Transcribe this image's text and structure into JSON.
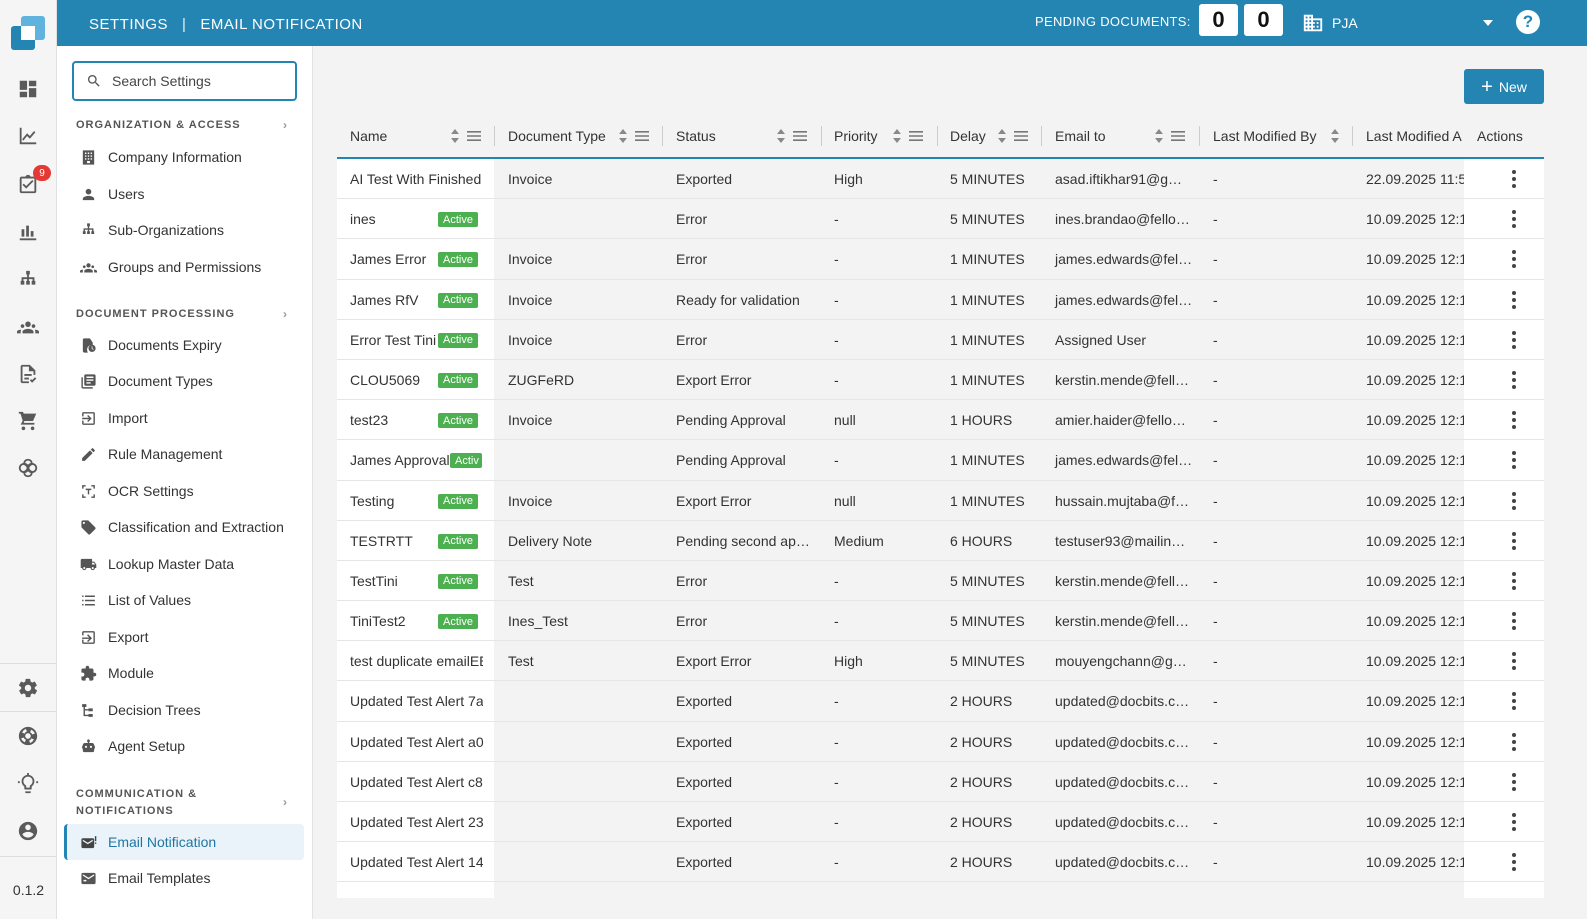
{
  "topbar": {
    "crumb_settings": "SETTINGS",
    "crumb_page": "EMAIL NOTIFICATION",
    "pending_label": "PENDING DOCUMENTS:",
    "pending_count_1": "0",
    "pending_count_2": "0",
    "org_name": "PJA"
  },
  "rail": {
    "badge_count": "9",
    "version": "0.1.2"
  },
  "sidebar": {
    "search_placeholder": "Search Settings",
    "sections": {
      "org": "ORGANIZATION & ACCESS",
      "doc": "DOCUMENT PROCESSING",
      "comm_line1": "COMMUNICATION &",
      "comm_line2": "NOTIFICATIONS"
    },
    "items": {
      "company": "Company Information",
      "users": "Users",
      "suborgs": "Sub-Organizations",
      "groups": "Groups and Permissions",
      "expiry": "Documents Expiry",
      "doctypes": "Document Types",
      "import": "Import",
      "rules": "Rule Management",
      "ocr": "OCR Settings",
      "classification": "Classification and Extraction",
      "lookup": "Lookup Master Data",
      "lov": "List of Values",
      "export": "Export",
      "module": "Module",
      "decision": "Decision Trees",
      "agent": "Agent Setup",
      "email_notification": "Email Notification",
      "email_templates": "Email Templates"
    }
  },
  "main": {
    "new_button": "New",
    "columns": {
      "name": "Name",
      "doctype": "Document Type",
      "status": "Status",
      "priority": "Priority",
      "delay": "Delay",
      "email": "Email to",
      "modified_by": "Last Modified By",
      "modified_at": "Last Modified A",
      "actions": "Actions"
    },
    "rows": [
      {
        "name": "AI Test With Finished",
        "active": "",
        "doctype": "Invoice",
        "status": "Exported",
        "priority": "High",
        "delay": "5 MINUTES",
        "email": "asad.iftikhar91@g…",
        "by": "-",
        "at": "22.09.2025 11:5"
      },
      {
        "name": "ines",
        "active": "Active",
        "doctype": "",
        "status": "Error",
        "priority": "-",
        "delay": "5 MINUTES",
        "email": "ines.brandao@fello…",
        "by": "-",
        "at": "10.09.2025 12:1"
      },
      {
        "name": "James Error",
        "active": "Active",
        "doctype": "Invoice",
        "status": "Error",
        "priority": "-",
        "delay": "1 MINUTES",
        "email": "james.edwards@fel…",
        "by": "-",
        "at": "10.09.2025 12:1"
      },
      {
        "name": "James RfV",
        "active": "Active",
        "doctype": "Invoice",
        "status": "Ready for validation",
        "priority": "-",
        "delay": "1 MINUTES",
        "email": "james.edwards@fel…",
        "by": "-",
        "at": "10.09.2025 12:1"
      },
      {
        "name": "Error Test Tini",
        "active": "Active",
        "doctype": "Invoice",
        "status": "Error",
        "priority": "-",
        "delay": "1 MINUTES",
        "email": "Assigned User",
        "by": "-",
        "at": "10.09.2025 12:1"
      },
      {
        "name": "CLOU5069",
        "active": "Active",
        "doctype": "ZUGFeRD",
        "status": "Export Error",
        "priority": "-",
        "delay": "1 MINUTES",
        "email": "kerstin.mende@fell…",
        "by": "-",
        "at": "10.09.2025 12:1"
      },
      {
        "name": "test23",
        "active": "Active",
        "doctype": "Invoice",
        "status": "Pending Approval",
        "priority": "null",
        "delay": "1 HOURS",
        "email": "amier.haider@fello…",
        "by": "-",
        "at": "10.09.2025 12:1"
      },
      {
        "name": "James Approval",
        "active": "Activ",
        "doctype": "",
        "status": "Pending Approval",
        "priority": "-",
        "delay": "1 MINUTES",
        "email": "james.edwards@fel…",
        "by": "-",
        "at": "10.09.2025 12:1"
      },
      {
        "name": "Testing",
        "active": "Active",
        "doctype": "Invoice",
        "status": "Export Error",
        "priority": "null",
        "delay": "1 MINUTES",
        "email": "hussain.mujtaba@f…",
        "by": "-",
        "at": "10.09.2025 12:1"
      },
      {
        "name": "TESTRTT",
        "active": "Active",
        "doctype": "Delivery Note",
        "status": "Pending second ap…",
        "priority": "Medium",
        "delay": "6 HOURS",
        "email": "testuser93@mailin…",
        "by": "-",
        "at": "10.09.2025 12:1"
      },
      {
        "name": "TestTini",
        "active": "Active",
        "doctype": "Test",
        "status": "Error",
        "priority": "-",
        "delay": "5 MINUTES",
        "email": "kerstin.mende@fell…",
        "by": "-",
        "at": "10.09.2025 12:1"
      },
      {
        "name": "TiniTest2",
        "active": "Active",
        "doctype": "Ines_Test",
        "status": "Error",
        "priority": "-",
        "delay": "5 MINUTES",
        "email": "kerstin.mende@fell…",
        "by": "-",
        "at": "10.09.2025 12:1"
      },
      {
        "name": "test duplicate emailEE",
        "active": "",
        "doctype": "Test",
        "status": "Export Error",
        "priority": "High",
        "delay": "5 MINUTES",
        "email": "mouyengchann@g…",
        "by": "-",
        "at": "10.09.2025 12:1"
      },
      {
        "name": "Updated Test Alert 7a",
        "active": "",
        "doctype": "",
        "status": "Exported",
        "priority": "-",
        "delay": "2 HOURS",
        "email": "updated@docbits.c…",
        "by": "-",
        "at": "10.09.2025 12:1"
      },
      {
        "name": "Updated Test Alert a0",
        "active": "",
        "doctype": "",
        "status": "Exported",
        "priority": "-",
        "delay": "2 HOURS",
        "email": "updated@docbits.c…",
        "by": "-",
        "at": "10.09.2025 12:1"
      },
      {
        "name": "Updated Test Alert c8",
        "active": "",
        "doctype": "",
        "status": "Exported",
        "priority": "-",
        "delay": "2 HOURS",
        "email": "updated@docbits.c…",
        "by": "-",
        "at": "10.09.2025 12:1"
      },
      {
        "name": "Updated Test Alert 23",
        "active": "",
        "doctype": "",
        "status": "Exported",
        "priority": "-",
        "delay": "2 HOURS",
        "email": "updated@docbits.c…",
        "by": "-",
        "at": "10.09.2025 12:1"
      },
      {
        "name": "Updated Test Alert 14",
        "active": "",
        "doctype": "",
        "status": "Exported",
        "priority": "-",
        "delay": "2 HOURS",
        "email": "updated@docbits.c…",
        "by": "-",
        "at": "10.09.2025 12:1"
      }
    ]
  },
  "colors": {
    "primary": "#2485b3",
    "active_badge": "#4caf50",
    "notification_badge": "#e53935"
  }
}
